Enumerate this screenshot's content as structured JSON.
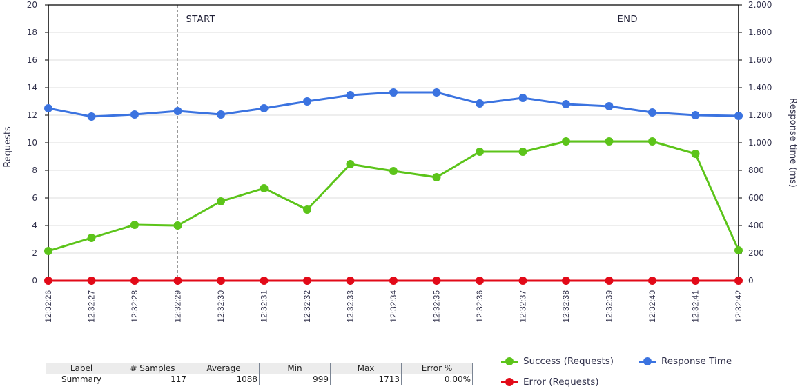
{
  "chart_data": {
    "type": "line",
    "title": "",
    "xlabel": "",
    "ylabel": "Requests",
    "y2label": "Response time (ms)",
    "ylim": [
      0,
      20
    ],
    "y2lim": [
      0,
      2000
    ],
    "yticks": [
      "0",
      "2",
      "4",
      "6",
      "8",
      "10",
      "12",
      "14",
      "16",
      "18",
      "20"
    ],
    "y2ticks": [
      "0",
      "200",
      "400",
      "600",
      "800",
      "1.000",
      "1.200",
      "1.400",
      "1.600",
      "1.800",
      "2.000"
    ],
    "grid": true,
    "legend_position": "bottom-right",
    "x": [
      "12:32:26",
      "12:32:27",
      "12:32:28",
      "12:32:29",
      "12:32:30",
      "12:32:31",
      "12:32:32",
      "12:32:33",
      "12:32:34",
      "12:32:35",
      "12:32:36",
      "12:32:37",
      "12:32:38",
      "12:32:39",
      "12:32:40",
      "12:32:41",
      "12:32:42"
    ],
    "series": [
      {
        "name": "Success (Requests)",
        "axis": "left",
        "color": "#5cc41a",
        "values": [
          2.15,
          3.1,
          4.05,
          4.0,
          5.75,
          6.7,
          5.15,
          8.45,
          7.95,
          7.5,
          9.35,
          9.35,
          10.1,
          10.1,
          10.1,
          9.2,
          2.2
        ]
      },
      {
        "name": "Response Time",
        "axis": "right",
        "color": "#3b73e0",
        "values": [
          1250,
          1190,
          1205,
          1230,
          1205,
          1250,
          1300,
          1345,
          1365,
          1365,
          1285,
          1325,
          1280,
          1265,
          1220,
          1200,
          1195
        ]
      },
      {
        "name": "Error (Requests)",
        "axis": "left",
        "color": "#e20a18",
        "values": [
          0,
          0,
          0,
          0,
          0,
          0,
          0,
          0,
          0,
          0,
          0,
          0,
          0,
          0,
          0,
          0,
          0
        ]
      }
    ],
    "annotations": [
      {
        "label": "START",
        "x": "12:32:29"
      },
      {
        "label": "END",
        "x": "12:32:39"
      }
    ]
  },
  "summary_table": {
    "columns": [
      "Label",
      "# Samples",
      "Average",
      "Min",
      "Max",
      "Error %"
    ],
    "rows": [
      [
        "Summary",
        "117",
        "1088",
        "999",
        "1713",
        "0.00%"
      ]
    ]
  },
  "legend": {
    "items": [
      {
        "label": "Success (Requests)",
        "color": "#5cc41a"
      },
      {
        "label": "Response Time",
        "color": "#3b73e0"
      },
      {
        "label": "Error (Requests)",
        "color": "#e20a18"
      }
    ]
  }
}
